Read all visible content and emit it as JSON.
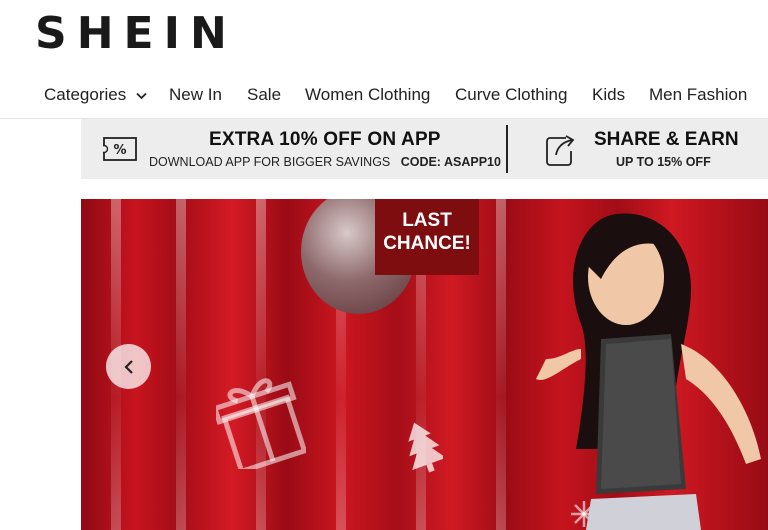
{
  "brand": {
    "logo_text": "SHEIN"
  },
  "nav": {
    "items": [
      {
        "label": "Categories",
        "has_dropdown": true
      },
      {
        "label": "New In"
      },
      {
        "label": "Sale"
      },
      {
        "label": "Women Clothing"
      },
      {
        "label": "Curve Clothing"
      },
      {
        "label": "Kids"
      },
      {
        "label": "Men Fashion"
      }
    ]
  },
  "promo": {
    "headline": "EXTRA 10% OFF ON APP",
    "sub_text": "DOWNLOAD APP FOR BIGGER SAVINGS",
    "code_text": "CODE: ASAPP10",
    "share_title": "SHARE & EARN",
    "share_sub": "UP TO 15% OFF",
    "icon_left": "percent-ticket-icon",
    "icon_right": "share-icon"
  },
  "banner": {
    "tag_line1": "LAST",
    "tag_line2": "CHANCE!",
    "prev_icon": "chevron-left-icon",
    "background_color": "#c8141f",
    "tag_color": "#7e0d10"
  }
}
